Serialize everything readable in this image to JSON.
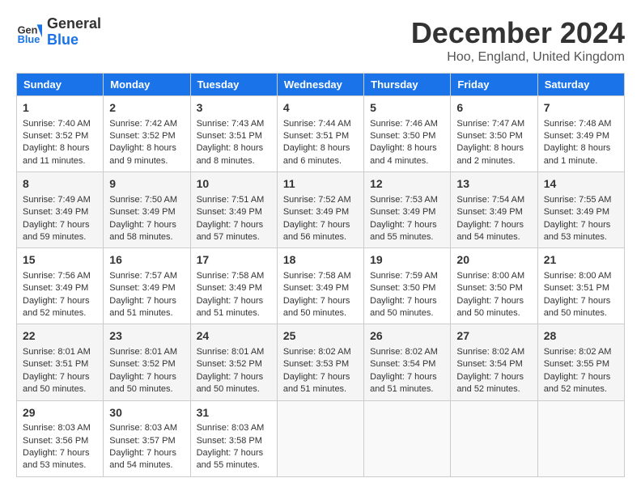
{
  "header": {
    "logo_text_general": "General",
    "logo_text_blue": "Blue",
    "month_title": "December 2024",
    "subtitle": "Hoo, England, United Kingdom"
  },
  "days_of_week": [
    "Sunday",
    "Monday",
    "Tuesday",
    "Wednesday",
    "Thursday",
    "Friday",
    "Saturday"
  ],
  "weeks": [
    [
      {
        "day": "1",
        "sunrise": "7:40 AM",
        "sunset": "3:52 PM",
        "daylight": "8 hours and 11 minutes."
      },
      {
        "day": "2",
        "sunrise": "7:42 AM",
        "sunset": "3:52 PM",
        "daylight": "8 hours and 9 minutes."
      },
      {
        "day": "3",
        "sunrise": "7:43 AM",
        "sunset": "3:51 PM",
        "daylight": "8 hours and 8 minutes."
      },
      {
        "day": "4",
        "sunrise": "7:44 AM",
        "sunset": "3:51 PM",
        "daylight": "8 hours and 6 minutes."
      },
      {
        "day": "5",
        "sunrise": "7:46 AM",
        "sunset": "3:50 PM",
        "daylight": "8 hours and 4 minutes."
      },
      {
        "day": "6",
        "sunrise": "7:47 AM",
        "sunset": "3:50 PM",
        "daylight": "8 hours and 2 minutes."
      },
      {
        "day": "7",
        "sunrise": "7:48 AM",
        "sunset": "3:49 PM",
        "daylight": "8 hours and 1 minute."
      }
    ],
    [
      {
        "day": "8",
        "sunrise": "7:49 AM",
        "sunset": "3:49 PM",
        "daylight": "7 hours and 59 minutes."
      },
      {
        "day": "9",
        "sunrise": "7:50 AM",
        "sunset": "3:49 PM",
        "daylight": "7 hours and 58 minutes."
      },
      {
        "day": "10",
        "sunrise": "7:51 AM",
        "sunset": "3:49 PM",
        "daylight": "7 hours and 57 minutes."
      },
      {
        "day": "11",
        "sunrise": "7:52 AM",
        "sunset": "3:49 PM",
        "daylight": "7 hours and 56 minutes."
      },
      {
        "day": "12",
        "sunrise": "7:53 AM",
        "sunset": "3:49 PM",
        "daylight": "7 hours and 55 minutes."
      },
      {
        "day": "13",
        "sunrise": "7:54 AM",
        "sunset": "3:49 PM",
        "daylight": "7 hours and 54 minutes."
      },
      {
        "day": "14",
        "sunrise": "7:55 AM",
        "sunset": "3:49 PM",
        "daylight": "7 hours and 53 minutes."
      }
    ],
    [
      {
        "day": "15",
        "sunrise": "7:56 AM",
        "sunset": "3:49 PM",
        "daylight": "7 hours and 52 minutes."
      },
      {
        "day": "16",
        "sunrise": "7:57 AM",
        "sunset": "3:49 PM",
        "daylight": "7 hours and 51 minutes."
      },
      {
        "day": "17",
        "sunrise": "7:58 AM",
        "sunset": "3:49 PM",
        "daylight": "7 hours and 51 minutes."
      },
      {
        "day": "18",
        "sunrise": "7:58 AM",
        "sunset": "3:49 PM",
        "daylight": "7 hours and 50 minutes."
      },
      {
        "day": "19",
        "sunrise": "7:59 AM",
        "sunset": "3:50 PM",
        "daylight": "7 hours and 50 minutes."
      },
      {
        "day": "20",
        "sunrise": "8:00 AM",
        "sunset": "3:50 PM",
        "daylight": "7 hours and 50 minutes."
      },
      {
        "day": "21",
        "sunrise": "8:00 AM",
        "sunset": "3:51 PM",
        "daylight": "7 hours and 50 minutes."
      }
    ],
    [
      {
        "day": "22",
        "sunrise": "8:01 AM",
        "sunset": "3:51 PM",
        "daylight": "7 hours and 50 minutes."
      },
      {
        "day": "23",
        "sunrise": "8:01 AM",
        "sunset": "3:52 PM",
        "daylight": "7 hours and 50 minutes."
      },
      {
        "day": "24",
        "sunrise": "8:01 AM",
        "sunset": "3:52 PM",
        "daylight": "7 hours and 50 minutes."
      },
      {
        "day": "25",
        "sunrise": "8:02 AM",
        "sunset": "3:53 PM",
        "daylight": "7 hours and 51 minutes."
      },
      {
        "day": "26",
        "sunrise": "8:02 AM",
        "sunset": "3:54 PM",
        "daylight": "7 hours and 51 minutes."
      },
      {
        "day": "27",
        "sunrise": "8:02 AM",
        "sunset": "3:54 PM",
        "daylight": "7 hours and 52 minutes."
      },
      {
        "day": "28",
        "sunrise": "8:02 AM",
        "sunset": "3:55 PM",
        "daylight": "7 hours and 52 minutes."
      }
    ],
    [
      {
        "day": "29",
        "sunrise": "8:03 AM",
        "sunset": "3:56 PM",
        "daylight": "7 hours and 53 minutes."
      },
      {
        "day": "30",
        "sunrise": "8:03 AM",
        "sunset": "3:57 PM",
        "daylight": "7 hours and 54 minutes."
      },
      {
        "day": "31",
        "sunrise": "8:03 AM",
        "sunset": "3:58 PM",
        "daylight": "7 hours and 55 minutes."
      },
      null,
      null,
      null,
      null
    ]
  ]
}
